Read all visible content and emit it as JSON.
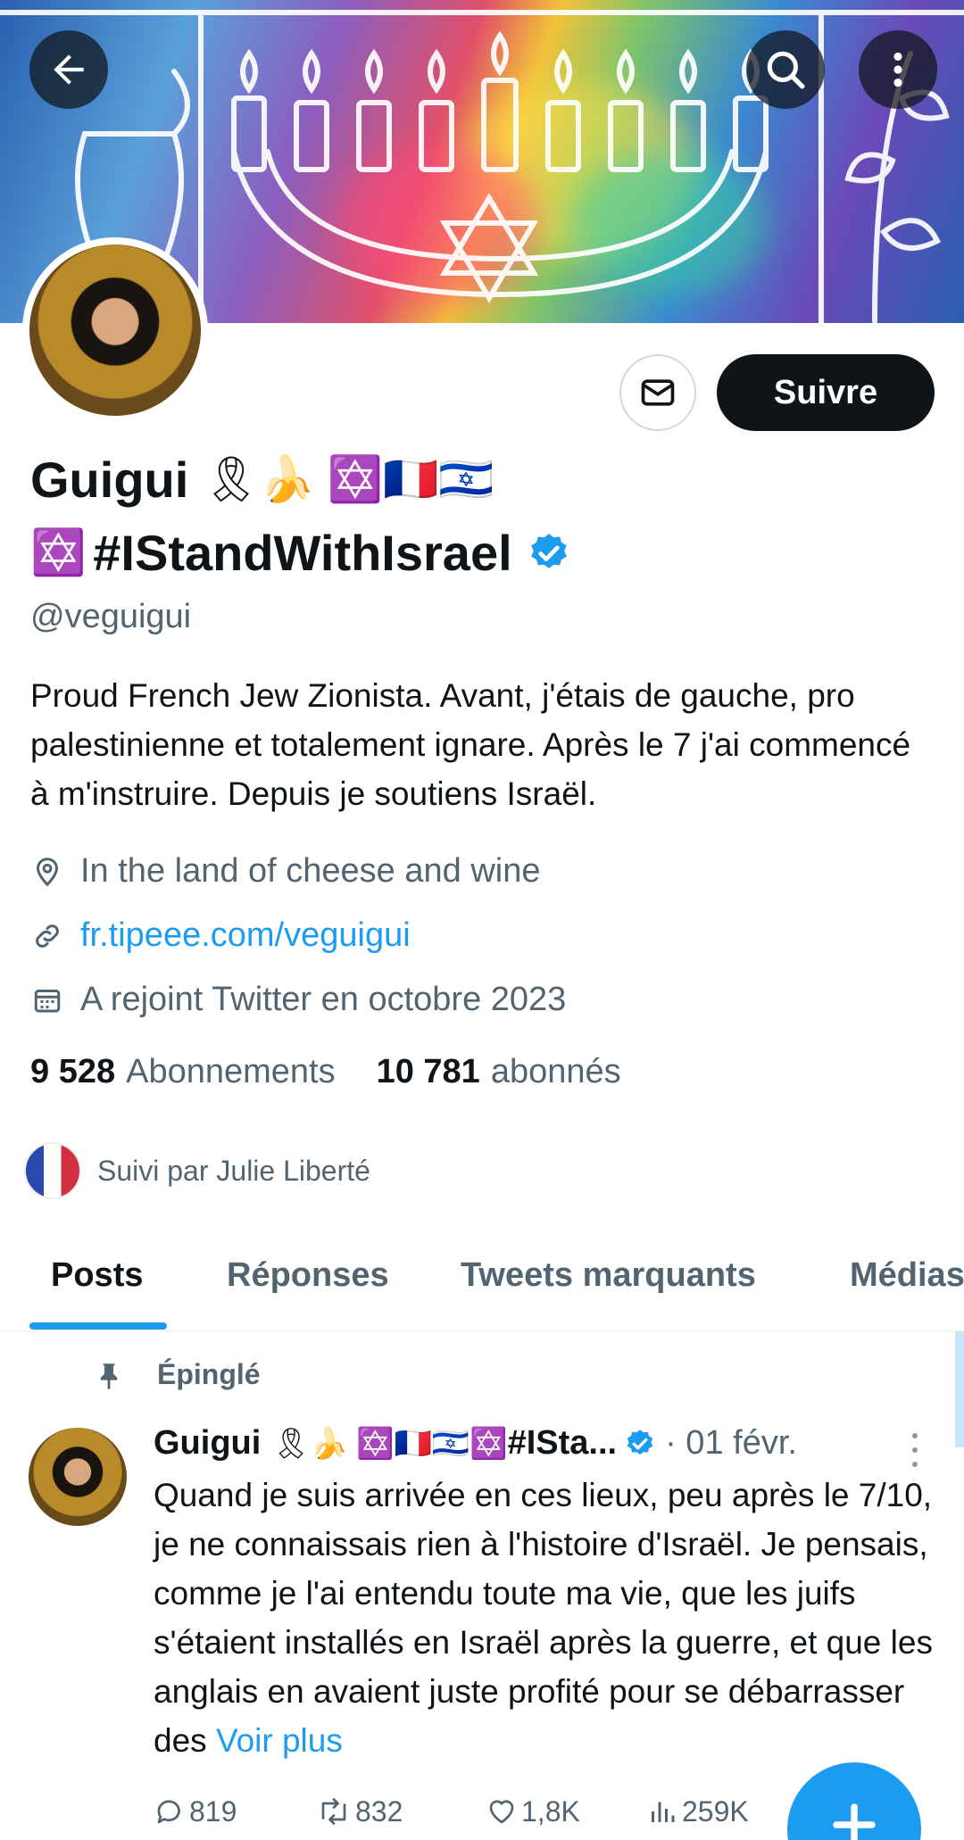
{
  "header": {
    "back_icon": "arrow-left-icon",
    "search_icon": "search-icon",
    "more_icon": "more-vertical-icon"
  },
  "profile": {
    "name_line1": "Guigui",
    "name_line1_emojis": "🎗🍌 ✡️🇫🇷🇮🇱",
    "name_line2_emoji": "✡️",
    "name_line2": "#IStandWithIsrael",
    "handle": "@veguigui",
    "follow_label": "Suivre",
    "bio": "Proud French Jew Zionista. Avant, j'étais de gauche, pro palestinienne et totalement ignare. Après le 7 j'ai commencé à m'instruire. Depuis je soutiens Israël.",
    "location": "In the land of cheese and wine",
    "website": "fr.tipeee.com/veguigui",
    "joined": "A rejoint Twitter en octobre 2023",
    "following_count": "9 528",
    "following_label": "Abonnements",
    "followers_count": "10 781",
    "followers_label": "abonnés",
    "followed_by": "Suivi par Julie Liberté"
  },
  "tabs": [
    {
      "label": "Posts",
      "active": true
    },
    {
      "label": "Réponses",
      "active": false
    },
    {
      "label": "Tweets marquants",
      "active": false
    },
    {
      "label": "Médias",
      "active": false
    }
  ],
  "pinned_post": {
    "pinned_label": "Épinglé",
    "author": "Guigui",
    "author_emojis": "🎗🍌 ✡️🇫🇷🇮🇱✡️",
    "author_tag": "#ISta...",
    "date": "· 01 févr.",
    "body": "Quand je suis arrivée en ces lieux, peu après le 7/10, je ne connaissais rien à l'histoire d'Israël. Je pensais, comme je l'ai entendu toute ma vie, que les juifs s'étaient installés en Israël après la guerre, et que les anglais en avaient juste profité pour se débarrasser des ",
    "see_more": "Voir plus",
    "replies": "819",
    "reposts": "832",
    "likes": "1,8K",
    "views": "259K"
  },
  "colors": {
    "accent": "#1d9bf0",
    "text": "#0f1419",
    "secondary": "#536471",
    "verified": "#1d9bf0"
  }
}
